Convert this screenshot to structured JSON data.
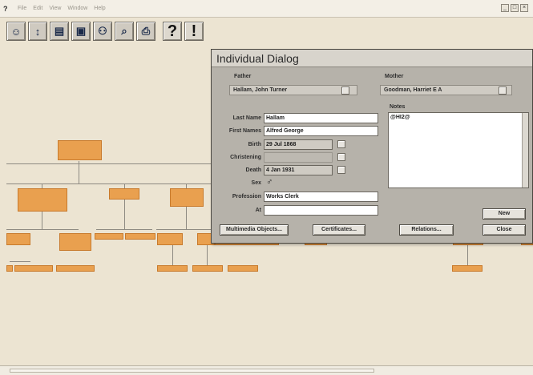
{
  "menubar": {
    "app_icon": "?",
    "items": [
      "File",
      "Edit",
      "View",
      "Window",
      "Help"
    ],
    "window_controls": [
      "_",
      "□",
      "×"
    ]
  },
  "toolbar": {
    "buttons": [
      {
        "icon": "person-icon",
        "glyph": "☺"
      },
      {
        "icon": "family-icon",
        "glyph": "↕"
      },
      {
        "icon": "chart-icon",
        "glyph": "▤"
      },
      {
        "icon": "box-icon",
        "glyph": "▣"
      },
      {
        "icon": "people-icon",
        "glyph": "⚇"
      },
      {
        "icon": "magnifier-icon",
        "glyph": "⌕"
      },
      {
        "icon": "printer-icon",
        "glyph": "⎙"
      },
      {
        "icon": "help-icon",
        "glyph": "?"
      },
      {
        "icon": "exclamation-icon",
        "glyph": "!"
      }
    ]
  },
  "dialog": {
    "title": "Individual Dialog",
    "father_label": "Father",
    "father_value": "Hallam, John Turner",
    "mother_label": "Mother",
    "mother_value": "Goodman, Harriet E A",
    "notes_label": "Notes",
    "notes_value": "@HI2@",
    "last_name_label": "Last Name",
    "last_name_value": "Hallam",
    "first_names_label": "First Names",
    "first_names_value": "Alfred George",
    "birth_label": "Birth",
    "birth_value": "29 Jul 1868",
    "christening_label": "Christening",
    "christening_value": "",
    "death_label": "Death",
    "death_value": "4 Jan 1931",
    "sex_label": "Sex",
    "sex_value": "♂",
    "profession_label": "Profession",
    "profession_value": "Works Clerk",
    "at_label": "At",
    "at_value": "",
    "buttons": {
      "multimedia": "Multimedia Objects...",
      "certificates": "Certificates...",
      "relations": "Relations...",
      "new": "New",
      "close": "Close"
    }
  },
  "colors": {
    "node_fill": "#e9a04f",
    "dialog_bg": "#b6b2aa",
    "background": "#ece4d2"
  }
}
